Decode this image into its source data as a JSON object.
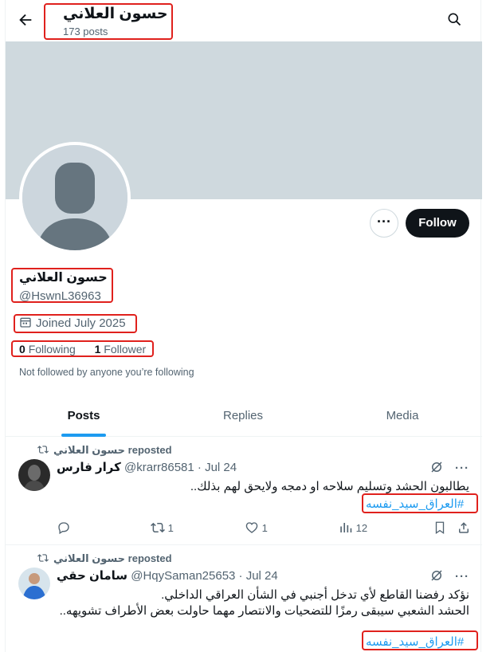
{
  "header": {
    "name": "حسون العلاني",
    "posts": "173 posts"
  },
  "profile": {
    "name": "حسون العلاني",
    "handle": "@HswnL36963",
    "joined": "Joined July 2025",
    "following_count": "0",
    "following_label": "Following",
    "followers_count": "1",
    "followers_label": "Follower",
    "not_followed": "Not followed by anyone you’re following",
    "follow_label": "Follow",
    "more_label": "···"
  },
  "tabs": [
    {
      "label": "Posts",
      "active": true
    },
    {
      "label": "Replies",
      "active": false
    },
    {
      "label": "Media",
      "active": false
    }
  ],
  "tweets": [
    {
      "repost_text": "حسون العلاني reposted",
      "name": "كرار فارس",
      "meta": "@krarr86581 · Jul 24",
      "lines": [
        "يطالبون الحشد وتسليم سلاحه او دمجه  ولايحق لهم بذلك.."
      ],
      "hashtag": "#العراق_سيد_نفسه",
      "replies": "",
      "reposts": "1",
      "likes": "1",
      "views": "12"
    },
    {
      "repost_text": "حسون العلاني reposted",
      "name": "سامان حقي",
      "meta": "@HqySaman25653 · Jul 24",
      "lines": [
        "نؤكد رفضنا القاطع لأي تدخل أجنبي في الشأن العراقي الداخلي.",
        "الحشد الشعبي سيبقى رمزًا للتضحيات والانتصار مهما حاولت بعض الأطراف تشويهه.."
      ],
      "hashtag": "#العراق_سيد_نفسه"
    }
  ],
  "colors": {
    "accent": "#1d9bf0",
    "highlight": "#e0211d",
    "banner": "#cfd9de"
  },
  "icons": [
    "back-arrow-icon",
    "search-icon",
    "calendar-icon",
    "repost-icon",
    "reply-icon",
    "like-icon",
    "views-icon",
    "bookmark-icon",
    "share-icon",
    "grok-icon",
    "more-icon"
  ]
}
